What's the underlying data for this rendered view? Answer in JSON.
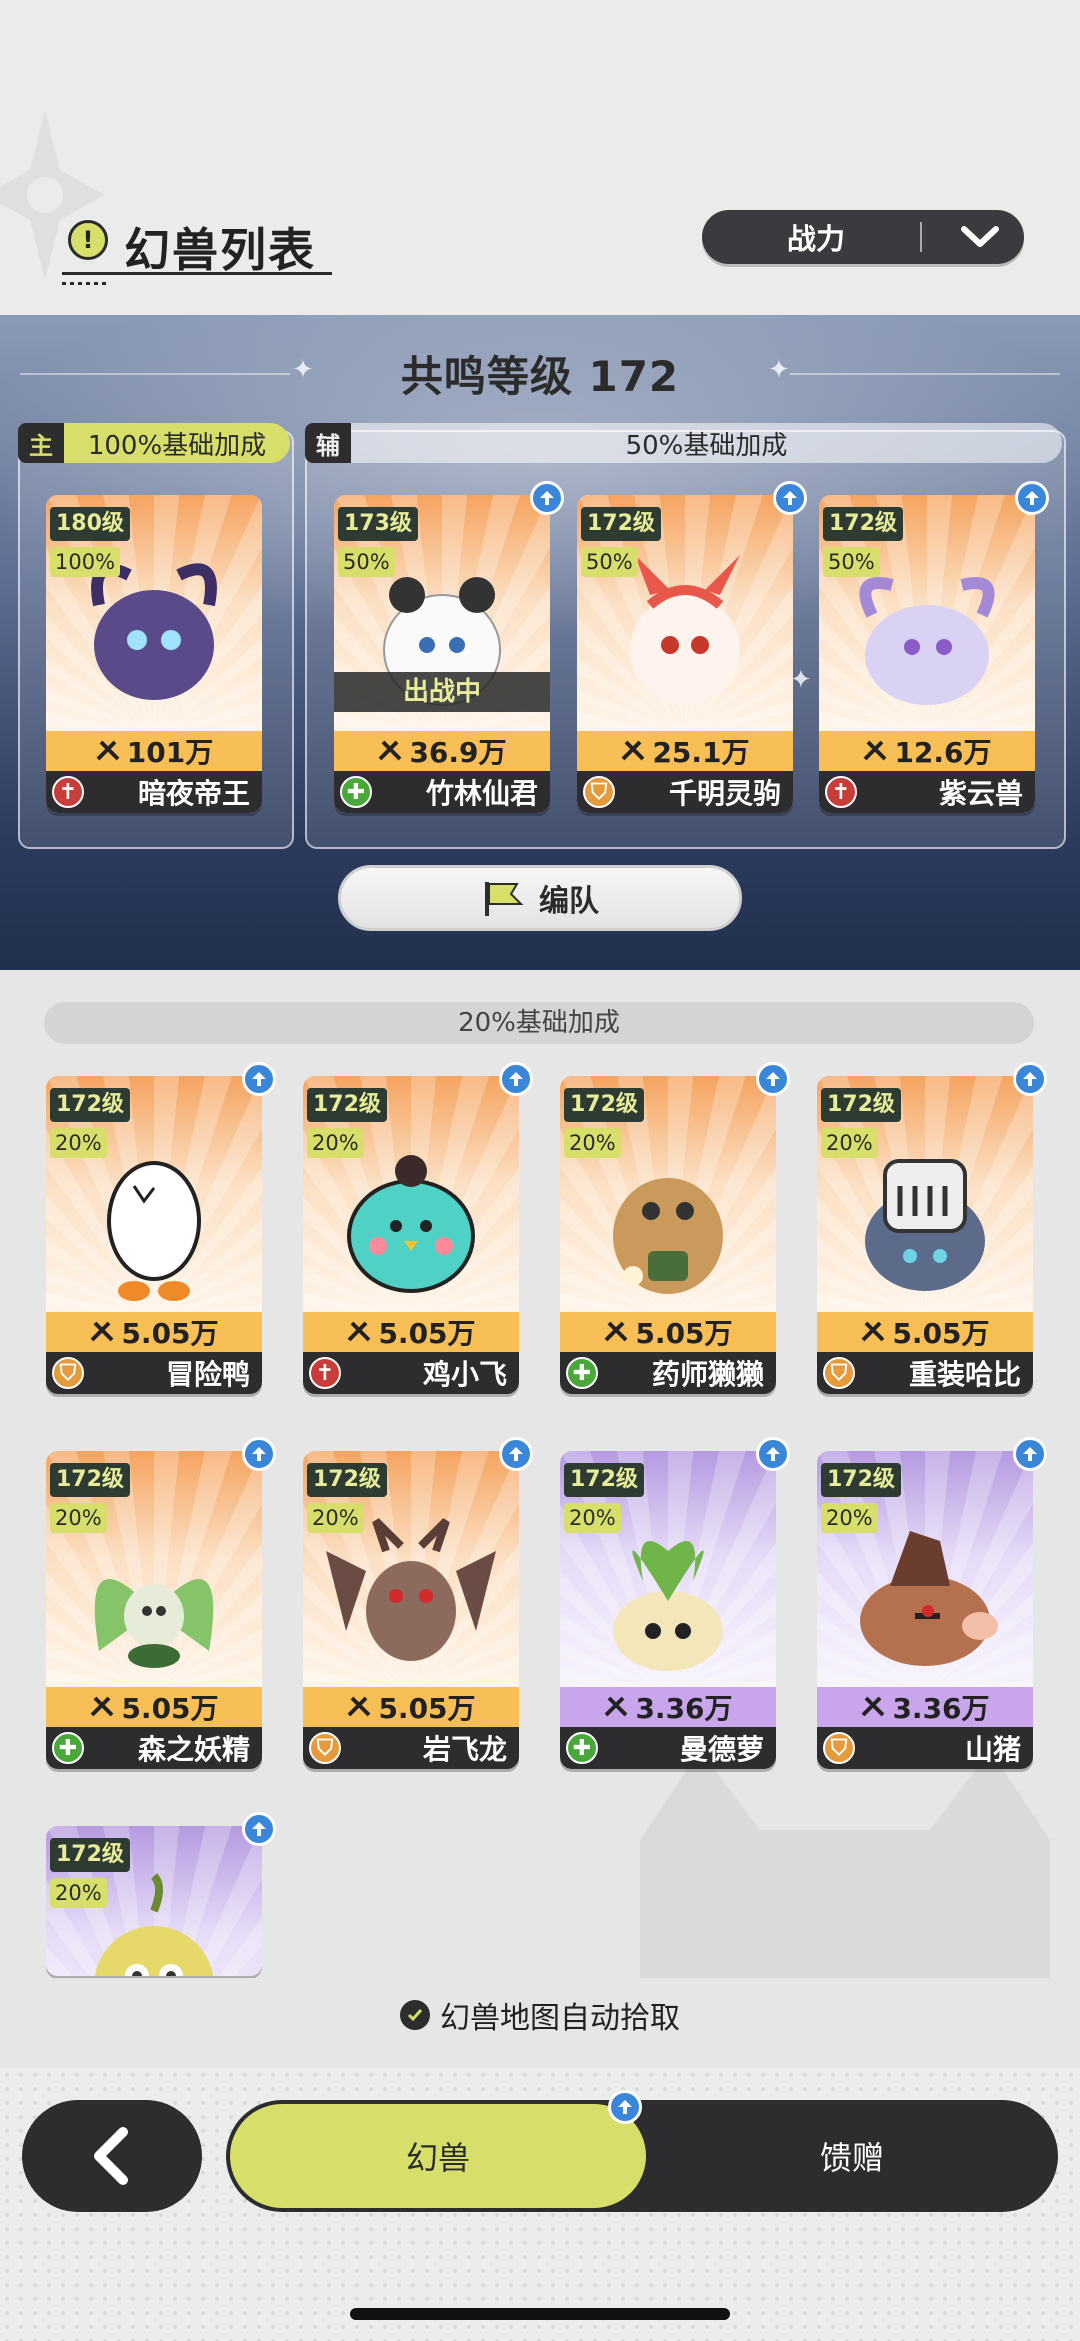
{
  "header": {
    "title": "幻兽列表",
    "title_icon": "!",
    "sort_label": "战力"
  },
  "resonance": {
    "title": "共鸣等级 172",
    "main_tag": "主",
    "main_bonus": "100%基础加成",
    "sub_tag": "辅",
    "sub_bonus": "50%基础加成",
    "team_button": "编队"
  },
  "main_cards": [
    {
      "level": "180级",
      "pct": "100%",
      "power": "101万",
      "name": "暗夜帝王",
      "role": "attack",
      "theme": "orange",
      "upgrade": false,
      "battle": ""
    },
    {
      "level": "173级",
      "pct": "50%",
      "power": "36.9万",
      "name": "竹林仙君",
      "role": "heal",
      "theme": "orange",
      "upgrade": true,
      "battle": "出战中"
    },
    {
      "level": "172级",
      "pct": "50%",
      "power": "25.1万",
      "name": "千明灵驹",
      "role": "defense",
      "theme": "orange",
      "upgrade": true,
      "battle": ""
    },
    {
      "level": "172级",
      "pct": "50%",
      "power": "12.6万",
      "name": "紫云兽",
      "role": "attack",
      "theme": "orange",
      "upgrade": true,
      "battle": ""
    }
  ],
  "list_section": {
    "bonus_label": "20%基础加成"
  },
  "list_cards": [
    {
      "level": "172级",
      "pct": "20%",
      "power": "5.05万",
      "name": "冒险鸭",
      "role": "defense",
      "theme": "orange"
    },
    {
      "level": "172级",
      "pct": "20%",
      "power": "5.05万",
      "name": "鸡小飞",
      "role": "attack",
      "theme": "orange"
    },
    {
      "level": "172级",
      "pct": "20%",
      "power": "5.05万",
      "name": "药师獭獭",
      "role": "heal",
      "theme": "orange"
    },
    {
      "level": "172级",
      "pct": "20%",
      "power": "5.05万",
      "name": "重装哈比",
      "role": "defense",
      "theme": "orange"
    },
    {
      "level": "172级",
      "pct": "20%",
      "power": "5.05万",
      "name": "森之妖精",
      "role": "heal",
      "theme": "orange"
    },
    {
      "level": "172级",
      "pct": "20%",
      "power": "5.05万",
      "name": "岩飞龙",
      "role": "defense",
      "theme": "orange"
    },
    {
      "level": "172级",
      "pct": "20%",
      "power": "3.36万",
      "name": "曼德萝",
      "role": "heal",
      "theme": "purple"
    },
    {
      "level": "172级",
      "pct": "20%",
      "power": "3.36万",
      "name": "山猪",
      "role": "defense",
      "theme": "purple"
    },
    {
      "level": "172级",
      "pct": "20%",
      "power": "",
      "name": "",
      "role": "",
      "theme": "purple"
    }
  ],
  "footer": {
    "auto_pick": "幻兽地图自动拾取",
    "tab_beasts": "幻兽",
    "tab_gift": "馈赠"
  },
  "colors": {
    "accent": "#d8de6a",
    "dark": "#2d2d2f",
    "upgrade_blue": "#3a86d8"
  }
}
